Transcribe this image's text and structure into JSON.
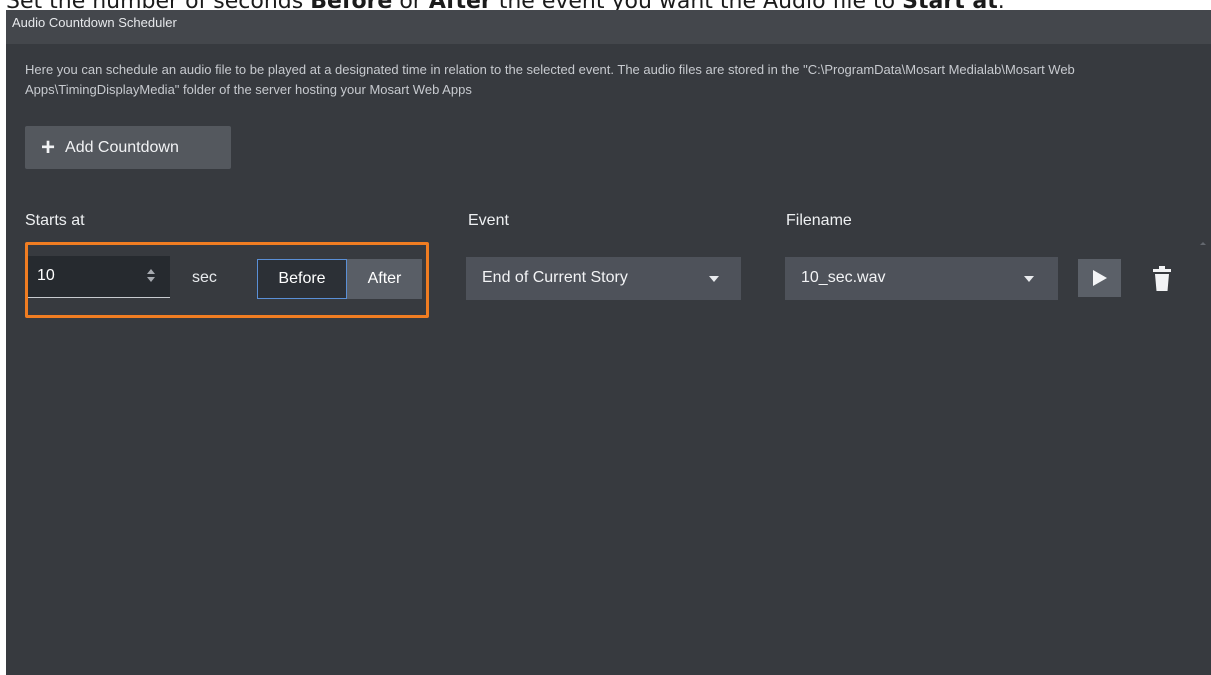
{
  "caption": {
    "prefix": "Set the number of seconds ",
    "before_word": "Before",
    "or_word": " or ",
    "after_word": "After",
    "middle": " the event you want the Audio file to ",
    "start_word": "Start at",
    "suffix": "."
  },
  "window": {
    "title": "Audio Countdown Scheduler"
  },
  "description": "Here you can schedule an audio file to be played at a designated time in relation to the selected event. The audio files are stored in the \"C:\\ProgramData\\Mosart Medialab\\Mosart Web Apps\\TimingDisplayMedia\" folder of the server hosting your Mosart Web Apps",
  "toolbar": {
    "add_icon": "+",
    "add_label": "Add Countdown"
  },
  "columns": {
    "starts_at": "Starts at",
    "event": "Event",
    "filename": "Filename"
  },
  "row": {
    "seconds_value": "10",
    "unit": "sec",
    "before_label": "Before",
    "after_label": "After",
    "selected_timing": "Before",
    "event_value": "End of Current Story",
    "filename_value": "10_sec.wav",
    "play_icon": "play-icon",
    "delete_icon": "trash-icon"
  },
  "colors": {
    "panel_bg": "#373a3f",
    "titlebar_bg": "#44474c",
    "highlight": "#f07d22",
    "selected_border": "#5a8fd6"
  }
}
